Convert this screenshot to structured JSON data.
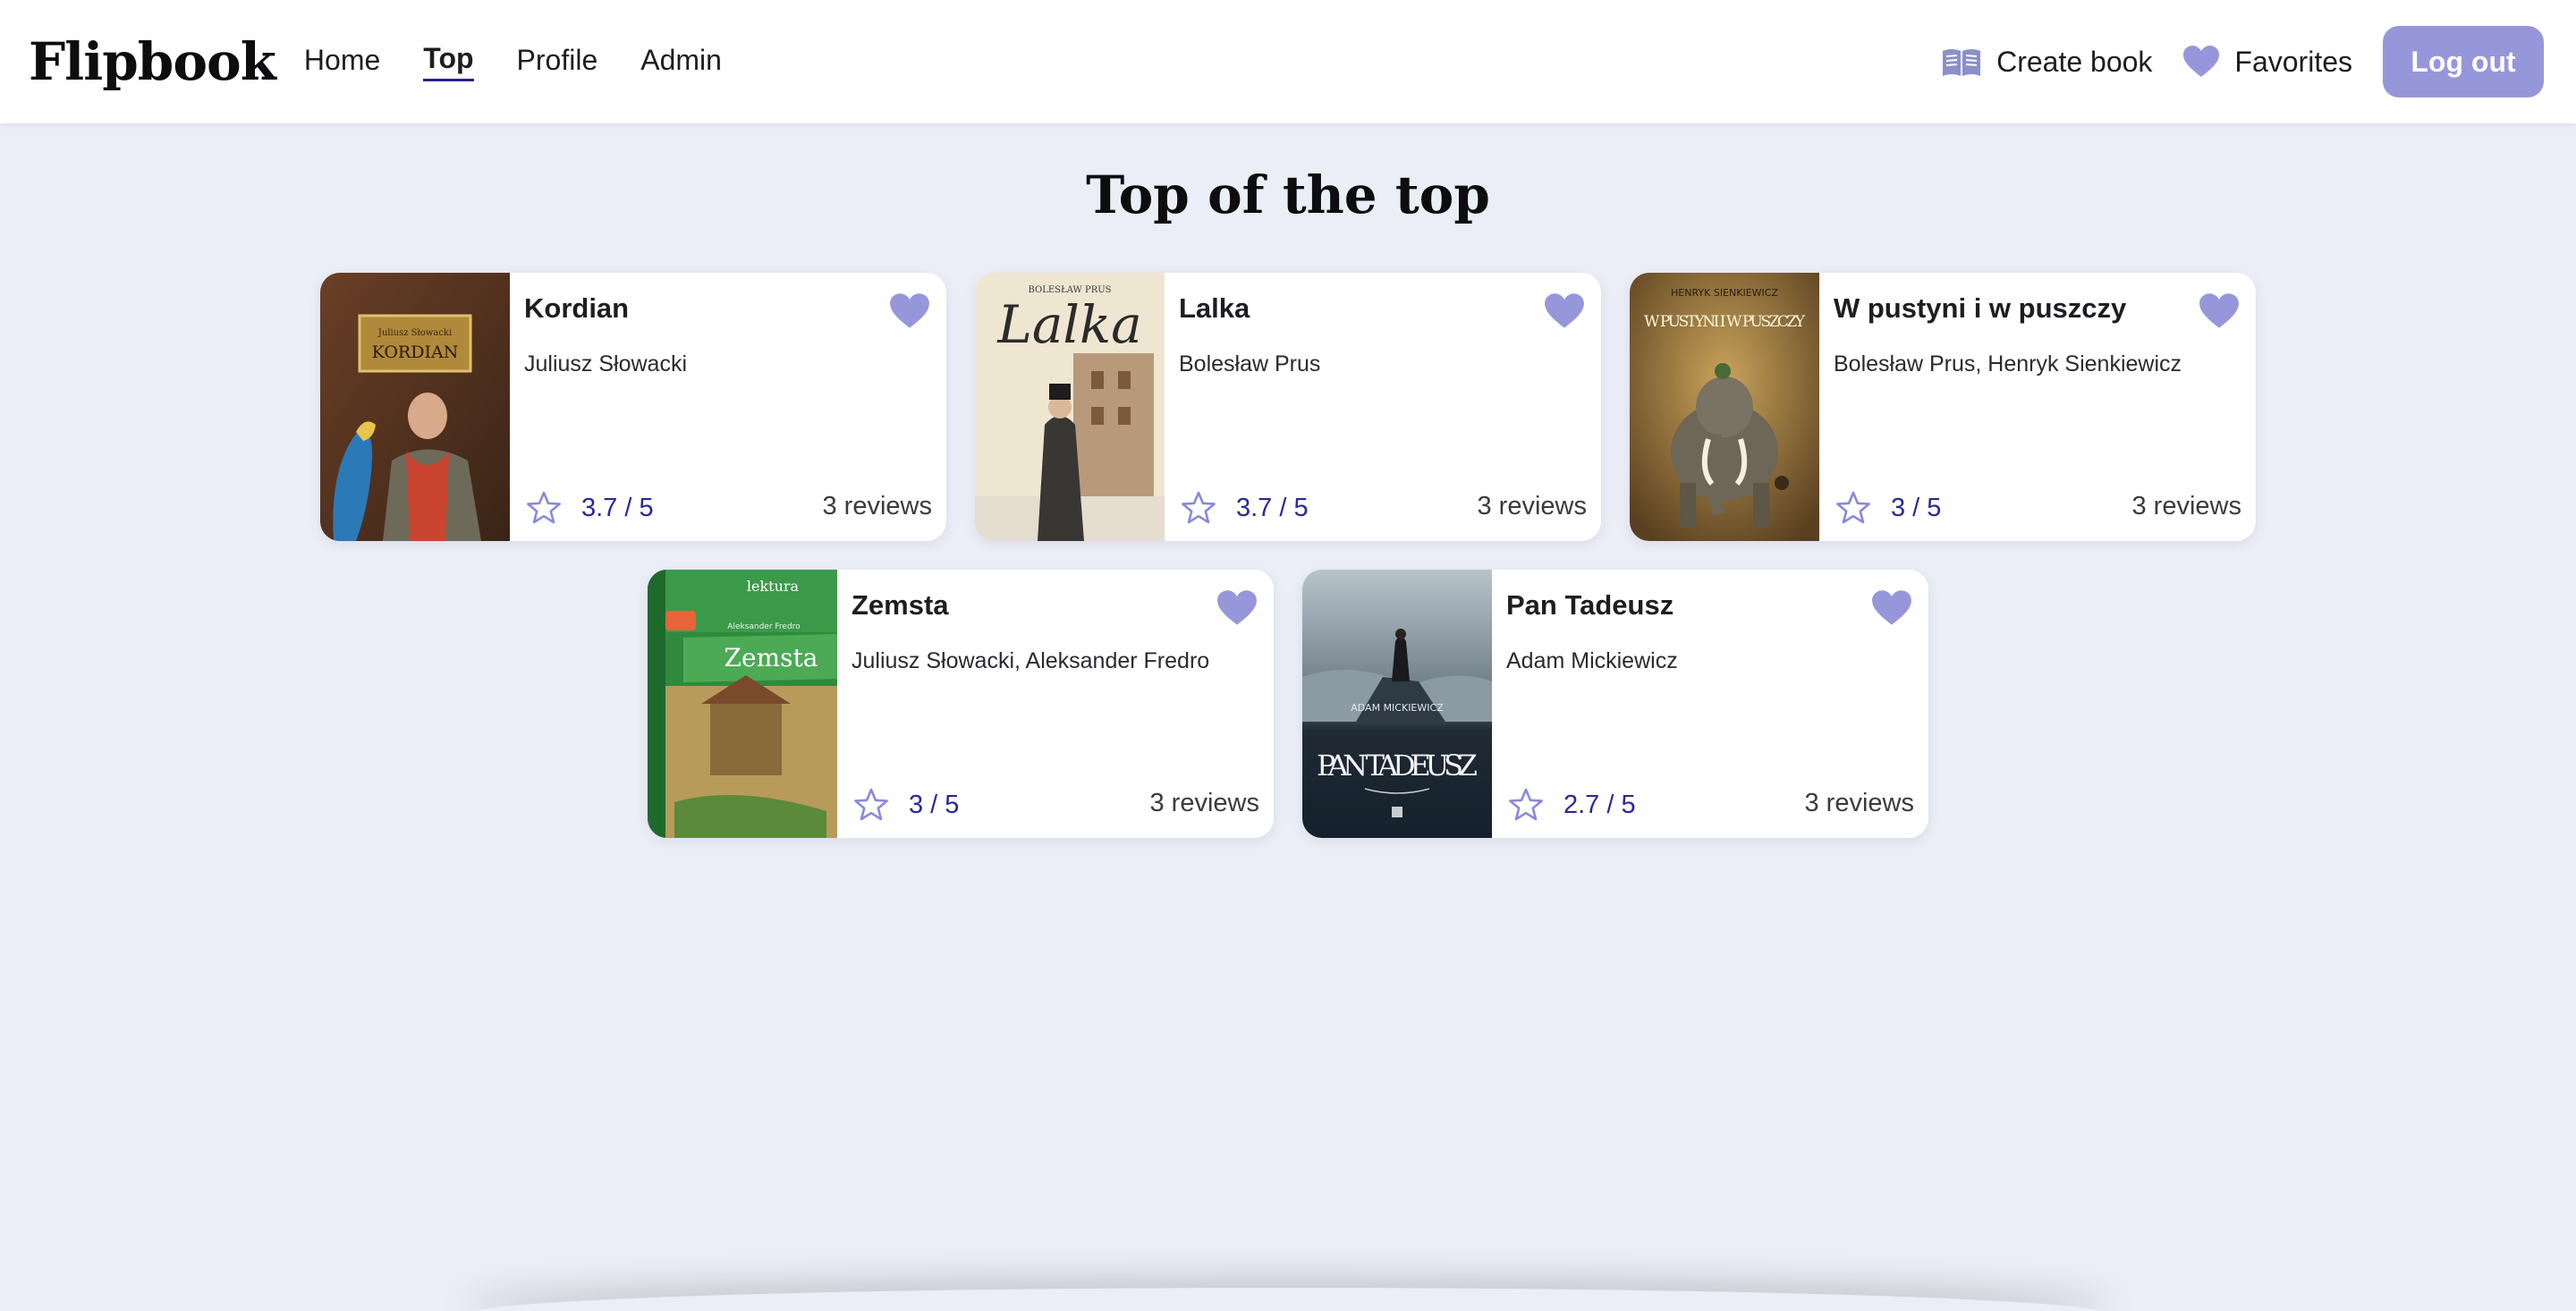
{
  "header": {
    "brand": "Flipbook",
    "nav": [
      {
        "label": "Home",
        "active": false
      },
      {
        "label": "Top",
        "active": true
      },
      {
        "label": "Profile",
        "active": false
      },
      {
        "label": "Admin",
        "active": false
      }
    ],
    "create_book": "Create book",
    "favorites": "Favorites",
    "logout": "Log out"
  },
  "page": {
    "title": "Top of the top"
  },
  "colors": {
    "accent": "#9696da",
    "rating_text": "#2a2893",
    "background": "#eceef7"
  },
  "books": [
    {
      "title": "Kordian",
      "authors": "Juliusz Słowacki",
      "rating": "3.7 / 5",
      "reviews": "3 reviews",
      "cover": {
        "author_line": "Juliusz Słowacki",
        "title_line": "KORDIAN"
      }
    },
    {
      "title": "Lalka",
      "authors": "Bolesław Prus",
      "rating": "3.7 / 5",
      "reviews": "3 reviews",
      "cover": {
        "author_line": "BOLESŁAW PRUS",
        "title_line": "Lalka"
      }
    },
    {
      "title": "W pustyni i w puszczy",
      "authors": "Bolesław Prus, Henryk Sienkiewicz",
      "rating": "3 / 5",
      "reviews": "3 reviews",
      "cover": {
        "author_line": "HENRYK SIENKIEWICZ",
        "title_line": "W PUSTYNI I W PUSZCZY"
      }
    },
    {
      "title": "Zemsta",
      "authors": "Juliusz Słowacki, Aleksander Fredro",
      "rating": "3 / 5",
      "reviews": "3 reviews",
      "cover": {
        "author_line": "Aleksander Fredro",
        "title_line": "Zemsta",
        "series_line": "lektura"
      }
    },
    {
      "title": "Pan Tadeusz",
      "authors": "Adam Mickiewicz",
      "rating": "2.7 / 5",
      "reviews": "3 reviews",
      "cover": {
        "author_line": "ADAM MICKIEWICZ",
        "title_line": "PAN TADEUSZ"
      }
    }
  ]
}
